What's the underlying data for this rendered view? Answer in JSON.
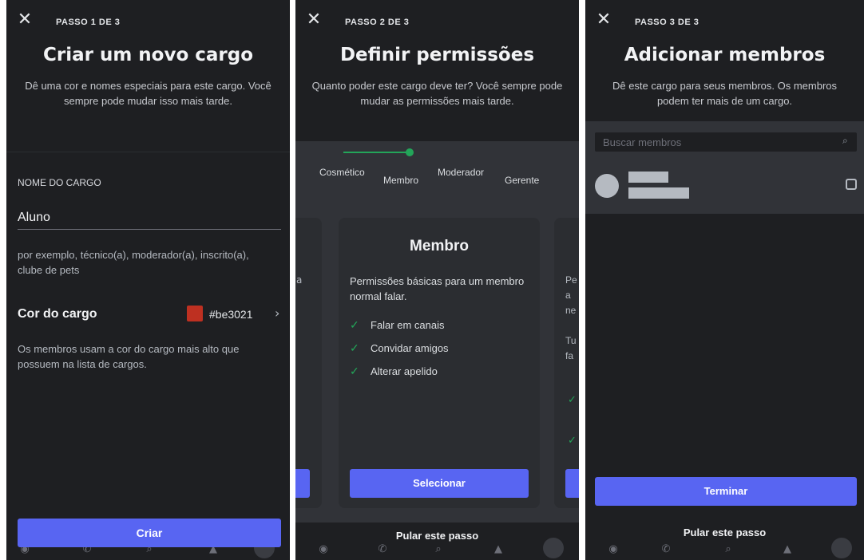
{
  "colors": {
    "accent": "#5865f2",
    "role_color": "#be3021",
    "check": "#23a559",
    "background": "#1e1f22"
  },
  "step1": {
    "step": "PASSO 1 DE 3",
    "title": "Criar um novo cargo",
    "subtitle": "Dê uma cor e nomes especiais para este cargo. Você sempre pode mudar isso mais tarde.",
    "name_label": "NOME DO CARGO",
    "name_value": "Aluno",
    "name_hint": "por exemplo, técnico(a), moderador(a), inscrito(a), clube de pets",
    "color_label": "Cor do cargo",
    "color_hex": "#be3021",
    "color_description": "Os membros usam a cor do cargo mais alto que possuem na lista de cargos.",
    "create_button": "Criar"
  },
  "step2": {
    "step": "PASSO 2 DE 3",
    "title": "Definir permissões",
    "subtitle": "Quanto poder este cargo deve ter? Você sempre pode mudar as permissões mais tarde.",
    "tiers": [
      "Cosmético",
      "Membro",
      "Moderador",
      "Gerente"
    ],
    "card_title": "Membro",
    "card_description": "Permissões básicas para um membro normal falar.",
    "permissions": [
      "Falar em canais",
      "Convidar amigos",
      "Alterar apelido"
    ],
    "select_button": "Selecionar",
    "skip": "Pular este passo"
  },
  "step3": {
    "step": "PASSO 3 DE 3",
    "title": "Adicionar membros",
    "subtitle": "Dê este cargo para seus membros. Os membros podem ter mais de um cargo.",
    "search_placeholder": "Buscar membros",
    "finish_button": "Terminar",
    "skip": "Pular este passo"
  },
  "icons": {
    "close": "close-icon",
    "chevron": "chevron-right-icon",
    "check": "check-icon",
    "search": "search-icon"
  }
}
